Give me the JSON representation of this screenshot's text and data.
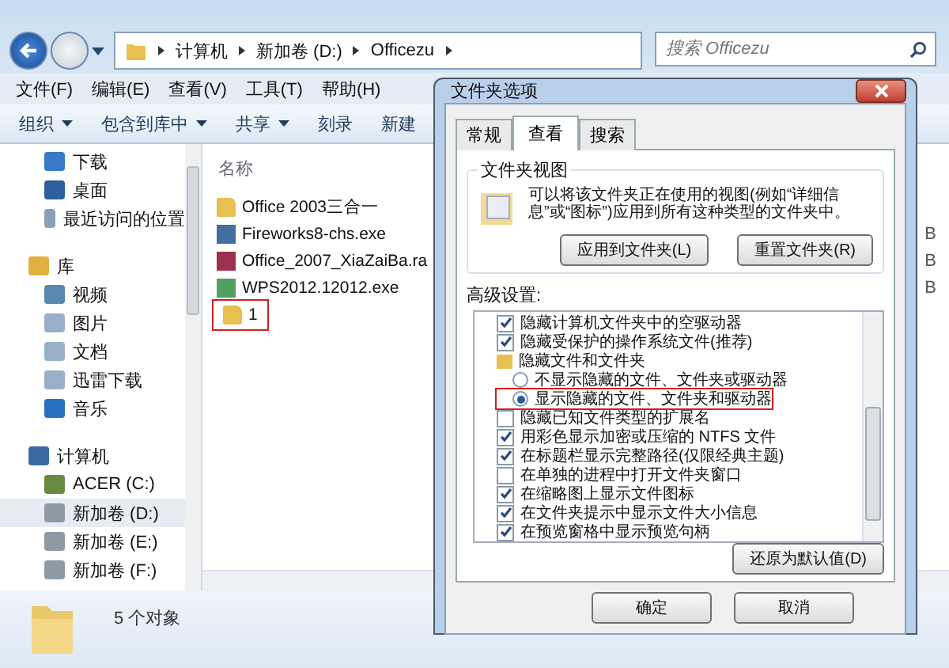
{
  "explorer": {
    "breadcrumb": [
      "计算机",
      "新加卷 (D:)",
      "Officezu"
    ],
    "search": {
      "placeholder": "搜索 Officezu"
    },
    "menu": [
      "文件(F)",
      "编辑(E)",
      "查看(V)",
      "工具(T)",
      "帮助(H)"
    ],
    "toolbar": [
      {
        "label": "组织",
        "dropdown": true
      },
      {
        "label": "包含到库中",
        "dropdown": true
      },
      {
        "label": "共享",
        "dropdown": true
      },
      {
        "label": "刻录",
        "dropdown": false
      },
      {
        "label": "新建",
        "dropdown": false
      }
    ],
    "nav_tree": [
      {
        "children": [
          {
            "label": "下载",
            "selected": false
          },
          {
            "label": "桌面",
            "selected": false
          },
          {
            "label": "最近访问的位置",
            "selected": false
          }
        ]
      },
      {
        "label": "库",
        "selected": false,
        "children": [
          {
            "label": "视频",
            "selected": false
          },
          {
            "label": "图片",
            "selected": false
          },
          {
            "label": "文档",
            "selected": false
          },
          {
            "label": "迅雷下载",
            "selected": false
          },
          {
            "label": "音乐",
            "selected": false
          }
        ]
      },
      {
        "label": "计算机",
        "selected": false,
        "children": [
          {
            "label": "ACER (C:)",
            "selected": false
          },
          {
            "label": "新加卷 (D:)",
            "selected": true
          },
          {
            "label": "新加卷 (E:)",
            "selected": false
          },
          {
            "label": "新加卷 (F:)",
            "selected": false
          }
        ]
      }
    ],
    "column": "名称",
    "files": [
      {
        "name": "Office 2003三合一",
        "kind": "folder"
      },
      {
        "name": "Fireworks8-chs.exe",
        "kind": "file",
        "size": "B"
      },
      {
        "name": "Office_2007_XiaZaiBa.ra",
        "kind": "file",
        "size": "B"
      },
      {
        "name": "WPS2012.12012.exe",
        "kind": "file",
        "size": "B"
      },
      {
        "name": "1",
        "kind": "folder",
        "color": "#d02020"
      }
    ],
    "status": "5 个对象"
  },
  "dialog": {
    "title": "文件夹选项",
    "tabs": [
      {
        "label": "常规",
        "selected": false
      },
      {
        "label": "查看",
        "selected": true
      },
      {
        "label": "搜索",
        "selected": false
      }
    ],
    "folder_views": {
      "title": "文件夹视图",
      "text": "可以将该文件夹正在使用的视图(例如“详细信息”或“图标”)应用到所有这种类型的文件夹中。",
      "buttons": [
        "应用到文件夹(L)",
        "重置文件夹(R)"
      ]
    },
    "advanced_label": "高级设置:",
    "settings": [
      {
        "kind": "checkbox",
        "label": "隐藏计算机文件夹中的空驱动器",
        "checked": true
      },
      {
        "kind": "checkbox",
        "label": "隐藏受保护的操作系统文件(推荐)",
        "checked": true
      },
      {
        "kind": "folder",
        "label": "隐藏文件和文件夹"
      },
      {
        "kind": "radio",
        "label": "不显示隐藏的文件、文件夹或驱动器",
        "selected": false,
        "highlighted": false
      },
      {
        "kind": "radio",
        "label": "显示隐藏的文件、文件夹和驱动器",
        "selected": true,
        "highlighted": true
      },
      {
        "kind": "checkbox",
        "label": "隐藏已知文件类型的扩展名",
        "checked": false
      },
      {
        "kind": "checkbox",
        "label": "用彩色显示加密或压缩的 NTFS 文件",
        "checked": true
      },
      {
        "kind": "checkbox",
        "label": "在标题栏显示完整路径(仅限经典主题)",
        "checked": true
      },
      {
        "kind": "checkbox",
        "label": "在单独的进程中打开文件夹窗口",
        "checked": false
      },
      {
        "kind": "checkbox",
        "label": "在缩略图上显示文件图标",
        "checked": true
      },
      {
        "kind": "checkbox",
        "label": "在文件夹提示中显示文件大小信息",
        "checked": true
      },
      {
        "kind": "checkbox",
        "label": "在预览窗格中显示预览句柄",
        "checked": true
      }
    ],
    "restore_button": "还原为默认值(D)",
    "buttons": [
      "确定",
      "取消"
    ]
  }
}
